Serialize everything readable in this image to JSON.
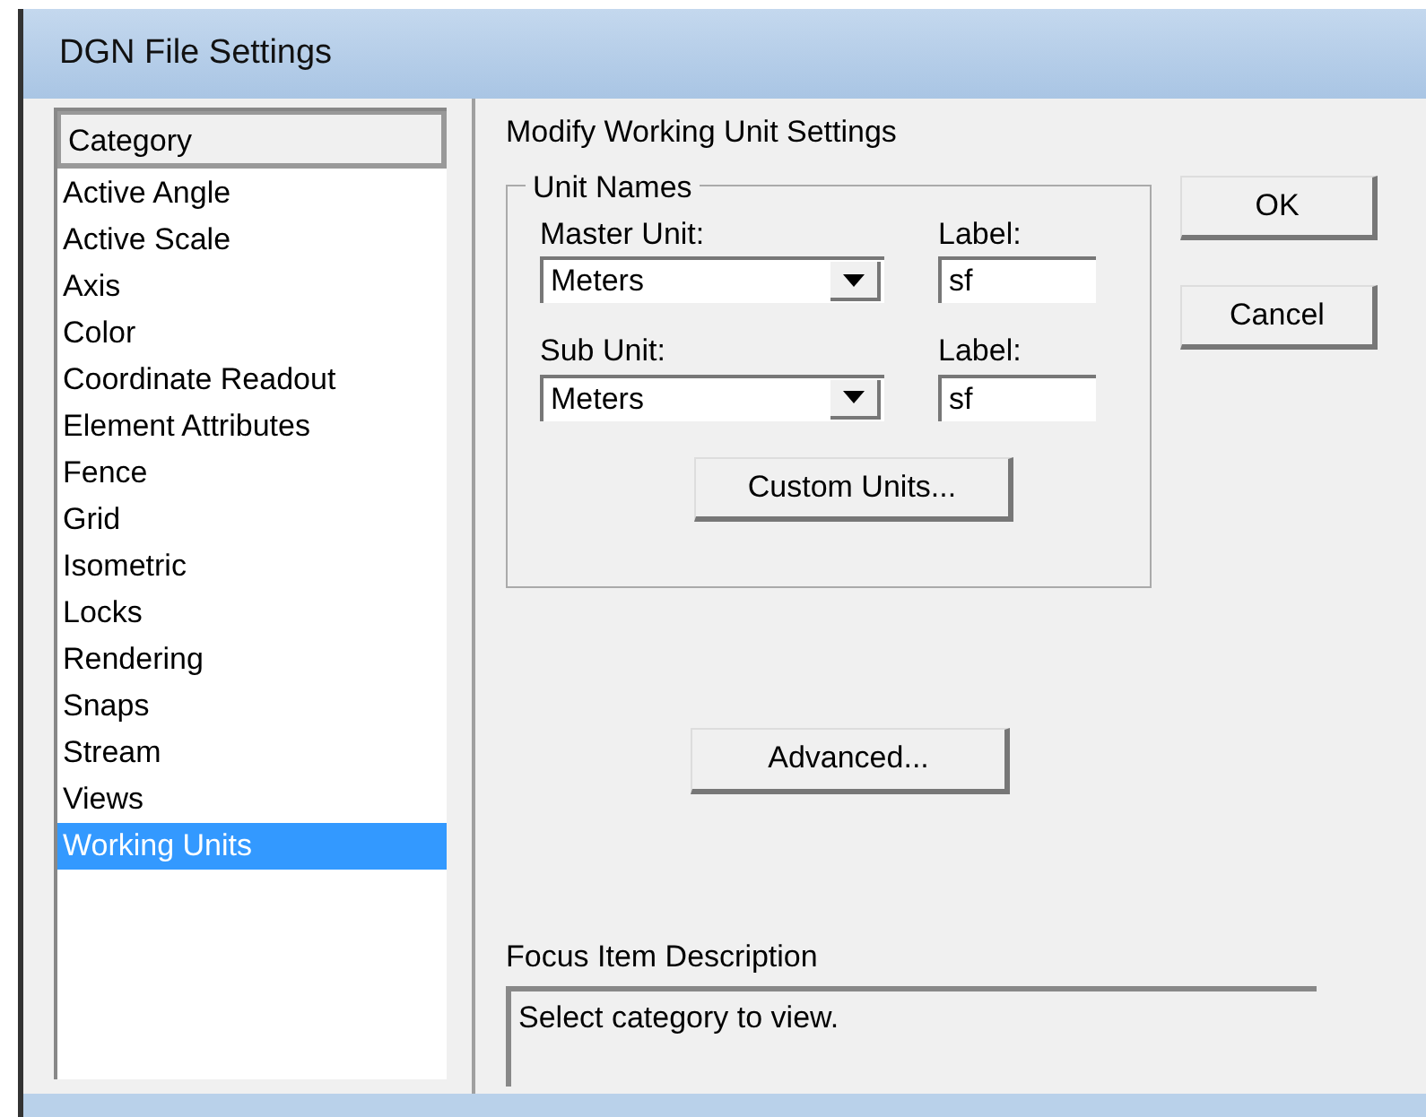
{
  "window": {
    "title": "DGN File Settings"
  },
  "category_list": {
    "header": "Category",
    "items": [
      {
        "label": "Active Angle",
        "selected": false
      },
      {
        "label": "Active Scale",
        "selected": false
      },
      {
        "label": "Axis",
        "selected": false
      },
      {
        "label": "Color",
        "selected": false
      },
      {
        "label": "Coordinate Readout",
        "selected": false
      },
      {
        "label": "Element Attributes",
        "selected": false
      },
      {
        "label": "Fence",
        "selected": false
      },
      {
        "label": "Grid",
        "selected": false
      },
      {
        "label": "Isometric",
        "selected": false
      },
      {
        "label": "Locks",
        "selected": false
      },
      {
        "label": "Rendering",
        "selected": false
      },
      {
        "label": "Snaps",
        "selected": false
      },
      {
        "label": "Stream",
        "selected": false
      },
      {
        "label": "Views",
        "selected": false
      },
      {
        "label": "Working Units",
        "selected": true
      }
    ]
  },
  "panel_title": "Modify Working Unit Settings",
  "unit_names": {
    "legend": "Unit Names",
    "rows": [
      {
        "unit_label": "Master Unit:",
        "unit_value": "Meters",
        "label_label": "Label:",
        "label_value": "sf"
      },
      {
        "unit_label": "Sub Unit:",
        "unit_value": "Meters",
        "label_label": "Label:",
        "label_value": "sf"
      }
    ],
    "custom_button": {
      "label": "Custom Units..."
    }
  },
  "buttons": [
    {
      "label": "OK"
    },
    {
      "label": "Cancel"
    }
  ],
  "advanced_button": {
    "label": "Advanced..."
  },
  "focus_description": {
    "label": "Focus Item Description",
    "text": "Select category to view."
  }
}
